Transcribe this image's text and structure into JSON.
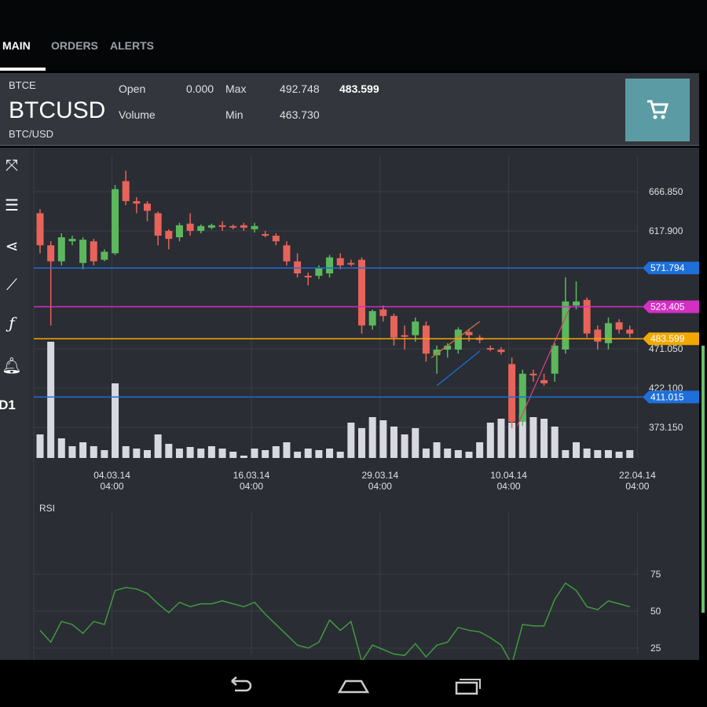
{
  "tabs": [
    {
      "label": "MAIN",
      "active": true
    },
    {
      "label": "ORDERS"
    },
    {
      "label": "ALERTS"
    }
  ],
  "instrument": {
    "exchange": "BTCE",
    "symbol": "BTCUSD",
    "pair": "BTC/USD"
  },
  "stats": {
    "open_label": "Open",
    "open_value": "0.000",
    "max_label": "Max",
    "max_value": "492.748",
    "last_value": "483.599",
    "volume_label": "Volume",
    "volume_value": "",
    "min_label": "Min",
    "min_value": "463.730"
  },
  "toolbar": [
    "fullscreen-icon",
    "settings-sliders-icon",
    "share-icon",
    "draw-line-icon",
    "indicator-function-icon",
    "alert-bell-icon"
  ],
  "timeframe": "D1",
  "colors": {
    "up": "#5cb85c",
    "down": "#e8635a",
    "blue_line": "#1e6fd9",
    "magenta_line": "#d42fc4",
    "orange_line": "#f0a800",
    "rsi": "#3f9a3f"
  },
  "chart_data": [
    {
      "type": "candlestick",
      "title": "BTCUSD",
      "ylim": [
        352,
        700
      ],
      "y_ticks": [
        "666.850",
        "617.900",
        "471.050",
        "422.100",
        "373.150"
      ],
      "y_tick_values": [
        666.85,
        617.9,
        471.05,
        422.1,
        373.15
      ],
      "x_labels": [
        {
          "date": "04.03.14",
          "time": "04:00",
          "index": 7
        },
        {
          "date": "16.03.14",
          "time": "04:00",
          "index": 20
        },
        {
          "date": "29.03.14",
          "time": "04:00",
          "index": 32
        },
        {
          "date": "10.04.14",
          "time": "04:00",
          "index": 44
        },
        {
          "date": "22.04.14",
          "time": "04:00",
          "index": 56
        }
      ],
      "price_lines": [
        {
          "label": "571.794",
          "value": 571.794,
          "color": "#1e6fd9"
        },
        {
          "label": "523.405",
          "value": 523.405,
          "color": "#d42fc4"
        },
        {
          "label": "483.599",
          "value": 483.599,
          "color": "#f0a800"
        },
        {
          "label": "411.015",
          "value": 411.015,
          "color": "#1e6fd9"
        }
      ],
      "trend_lines": [
        {
          "from": [
            36.5,
            460
          ],
          "to": [
            41,
            505
          ],
          "color": "#c8733a"
        },
        {
          "from": [
            37,
            425
          ],
          "to": [
            41,
            468
          ],
          "color": "#1e6fd9"
        },
        {
          "from": [
            44.5,
            375
          ],
          "to": [
            49.5,
            525
          ],
          "color": "#d4407a"
        }
      ],
      "ohlc": [
        [
          640,
          645,
          590,
          600
        ],
        [
          600,
          605,
          500,
          580
        ],
        [
          580,
          615,
          575,
          610
        ],
        [
          605,
          612,
          600,
          608
        ],
        [
          578,
          610,
          570,
          607
        ],
        [
          605,
          608,
          575,
          580
        ],
        [
          582,
          595,
          580,
          592
        ],
        [
          590,
          675,
          588,
          670
        ],
        [
          680,
          693,
          650,
          655
        ],
        [
          655,
          660,
          640,
          652
        ],
        [
          652,
          655,
          630,
          643
        ],
        [
          640,
          642,
          600,
          612
        ],
        [
          618,
          620,
          595,
          608
        ],
        [
          610,
          628,
          605,
          625
        ],
        [
          627,
          640,
          612,
          618
        ],
        [
          618,
          626,
          615,
          624
        ],
        [
          622,
          627,
          620,
          625
        ],
        [
          625,
          630,
          618,
          623
        ],
        [
          624,
          626,
          620,
          622
        ],
        [
          625,
          628,
          618,
          622
        ],
        [
          620,
          628,
          616,
          624
        ],
        [
          614,
          618,
          610,
          612
        ],
        [
          612,
          615,
          600,
          605
        ],
        [
          600,
          605,
          575,
          580
        ],
        [
          580,
          590,
          560,
          565
        ],
        [
          562,
          566,
          550,
          560
        ],
        [
          562,
          575,
          558,
          572
        ],
        [
          565,
          588,
          560,
          585
        ],
        [
          584,
          590,
          570,
          575
        ],
        [
          578,
          582,
          574,
          577
        ],
        [
          582,
          585,
          490,
          500
        ],
        [
          500,
          520,
          495,
          518
        ],
        [
          520,
          525,
          505,
          512
        ],
        [
          512,
          515,
          475,
          485
        ],
        [
          488,
          500,
          470,
          487
        ],
        [
          488,
          510,
          480,
          505
        ],
        [
          500,
          505,
          455,
          465
        ],
        [
          463,
          475,
          440,
          470
        ],
        [
          470,
          478,
          460,
          475
        ],
        [
          470,
          498,
          465,
          495
        ],
        [
          492,
          495,
          480,
          488
        ],
        [
          485,
          488,
          478,
          482
        ],
        [
          472,
          475,
          468,
          470
        ],
        [
          470,
          473,
          464,
          467
        ],
        [
          452,
          460,
          372,
          380
        ],
        [
          380,
          445,
          375,
          440
        ],
        [
          440,
          445,
          430,
          438
        ],
        [
          432,
          440,
          425,
          428
        ],
        [
          440,
          478,
          430,
          475
        ],
        [
          470,
          560,
          465,
          530
        ],
        [
          525,
          555,
          520,
          530
        ],
        [
          532,
          535,
          485,
          490
        ],
        [
          495,
          500,
          470,
          480
        ],
        [
          478,
          510,
          470,
          503
        ],
        [
          504,
          508,
          490,
          495
        ],
        [
          495,
          500,
          485,
          490
        ]
      ]
    },
    {
      "type": "bar",
      "title": "Volume",
      "values": [
        30,
        148,
        25,
        15,
        20,
        15,
        10,
        95,
        15,
        12,
        10,
        30,
        18,
        12,
        14,
        12,
        15,
        12,
        8,
        3,
        12,
        10,
        15,
        20,
        8,
        12,
        10,
        12,
        8,
        45,
        38,
        52,
        48,
        40,
        30,
        38,
        12,
        20,
        12,
        10,
        8,
        20,
        45,
        50,
        45,
        55,
        52,
        50,
        40,
        10,
        20,
        12,
        10,
        10,
        8,
        10
      ]
    },
    {
      "type": "line",
      "title": "RSI",
      "ylim": [
        0,
        100
      ],
      "y_ticks": [
        "75",
        "50",
        "25"
      ],
      "y_tick_values": [
        75,
        50,
        25
      ],
      "values": [
        37,
        29,
        43,
        41,
        35,
        43,
        41,
        64,
        66,
        65,
        62,
        55,
        49,
        56,
        53,
        55,
        55,
        57,
        55,
        53,
        56,
        48,
        41,
        34,
        27,
        25,
        29,
        44,
        37,
        43,
        16,
        27,
        24,
        21,
        20,
        28,
        19,
        27,
        29,
        39,
        37,
        36,
        32,
        27,
        14,
        41,
        40,
        40,
        58,
        69,
        64,
        53,
        51,
        57,
        55,
        53
      ]
    }
  ]
}
